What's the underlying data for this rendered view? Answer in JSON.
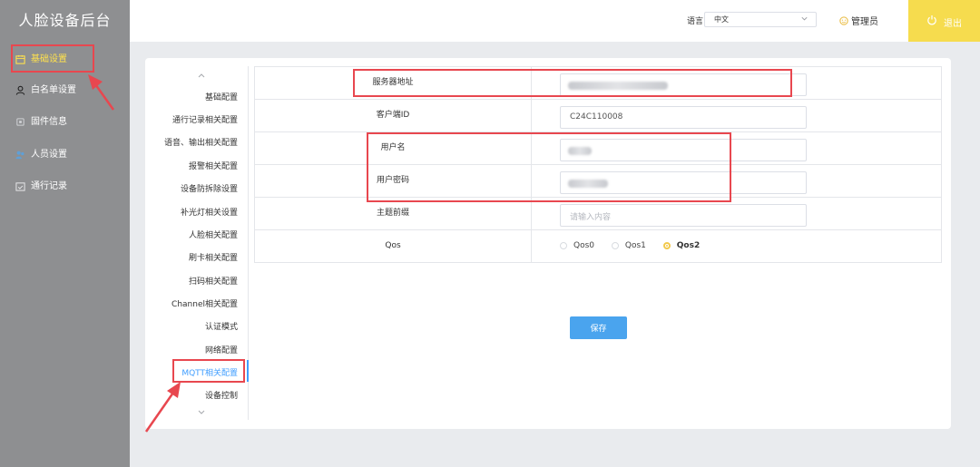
{
  "app": {
    "title": "人脸设备后台"
  },
  "sidebar": {
    "items": [
      {
        "label": "基础设置",
        "icon": "calendar-icon",
        "active": true
      },
      {
        "label": "白名单设置",
        "icon": "user-icon",
        "active": false
      },
      {
        "label": "固件信息",
        "icon": "chip-icon",
        "active": false
      },
      {
        "label": "人员设置",
        "icon": "users-icon",
        "active": false
      },
      {
        "label": "通行记录",
        "icon": "check-calendar-icon",
        "active": false
      }
    ]
  },
  "header": {
    "language_label": "语言",
    "language_value": "中文",
    "user_label": "管理员",
    "logout_label": "退出"
  },
  "subnav": {
    "items": [
      "基础配置",
      "通行记录相关配置",
      "语音、输出相关配置",
      "报警相关配置",
      "设备防拆除设置",
      "补光灯相关设置",
      "人脸相关配置",
      "刷卡相关配置",
      "扫码相关配置",
      "Channel相关配置",
      "认证模式",
      "网络配置",
      "MQTT相关配置",
      "设备控制"
    ],
    "active": "MQTT相关配置"
  },
  "form": {
    "server_label": "服务器地址",
    "client_id_label": "客户端ID",
    "client_id_value": "C24C110008",
    "username_label": "用户名",
    "password_label": "用户密码",
    "topic_label": "主题前缀",
    "topic_placeholder": "请输入内容",
    "qos_label": "Qos",
    "qos_options": [
      "Qos0",
      "Qos1",
      "Qos2"
    ],
    "qos_selected": "Qos2"
  },
  "actions": {
    "save_label": "保存"
  },
  "colors": {
    "sidebar_bg": "#8e8f91",
    "accent_yellow": "#f6dc4e",
    "link_blue": "#409eff",
    "save_button": "#4aa4ee",
    "annotation_red": "#e8474f"
  }
}
